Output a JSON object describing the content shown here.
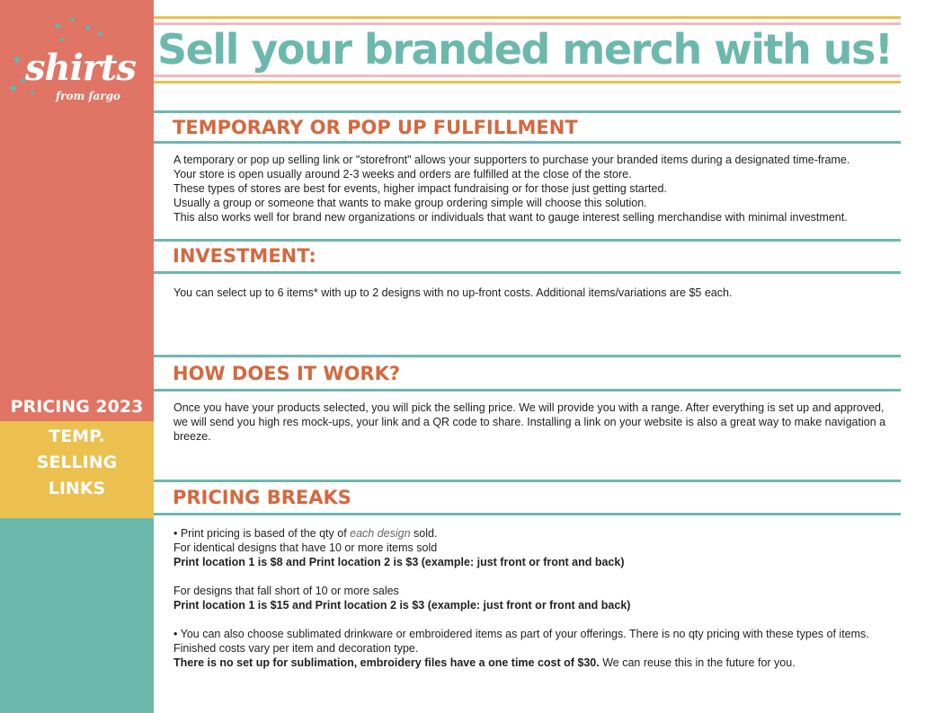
{
  "logo": {
    "word": "shirts",
    "sub": "from fargo"
  },
  "sidebar": {
    "pricing_label": "PRICING 2023",
    "temp_lines": [
      "TEMP.",
      "SELLING",
      "LINKS"
    ]
  },
  "headline": "Sell your branded merch with us!",
  "sections": {
    "temporary": {
      "title": "TEMPORARY OR POP UP FULFILLMENT",
      "lines": [
        "A temporary or pop up selling link or \"storefront\" allows your supporters to purchase your branded items during a designated time-frame.",
        "Your store is open usually around 2-3 weeks and orders are fulfilled at the close of the store.",
        "These types of stores are best for events, higher impact fundraising or for those just getting started.",
        "Usually a group or someone that wants to make group ordering simple will choose this solution.",
        "This also works well for brand new organizations or individuals that want to gauge interest selling merchandise with minimal investment."
      ]
    },
    "investment": {
      "title": "INVESTMENT:",
      "text": "You can select up to 6 items* with up to 2 designs with no up-front costs. Additional items/variations are $5 each."
    },
    "how": {
      "title": "HOW DOES IT WORK?",
      "text": "Once you have your products selected, you will pick the selling price. We will provide you with a range. After everything is set up and approved, we will send you high res mock-ups, your link and a QR code to share.  Installing a link on your website is also a great way to make navigation a breeze."
    },
    "pricing": {
      "title": "PRICING BREAKS",
      "bullet1_pre": "• Print pricing is based of the qty of ",
      "bullet1_em": "each design",
      "bullet1_post": " sold.",
      "line2": "For identical designs that have 10 or more items sold",
      "line3": "Print location 1 is $8 and Print location 2 is $3  (example: just front or front and back)",
      "line4": "For designs that fall short of 10 or more sales",
      "line5": "Print location 1 is $15 and Print location 2 is $3  (example: just front or front and back)",
      "bullet2": "• You can also choose sublimated drinkware or embroidered items as part of your offerings. There is no qty pricing with these types of items. Finished costs vary per item and decoration type.",
      "last_bold": "There is no set up for sublimation, embroidery files have a one time cost of $30.",
      "last_rest": " We can reuse this in the future for you."
    }
  }
}
